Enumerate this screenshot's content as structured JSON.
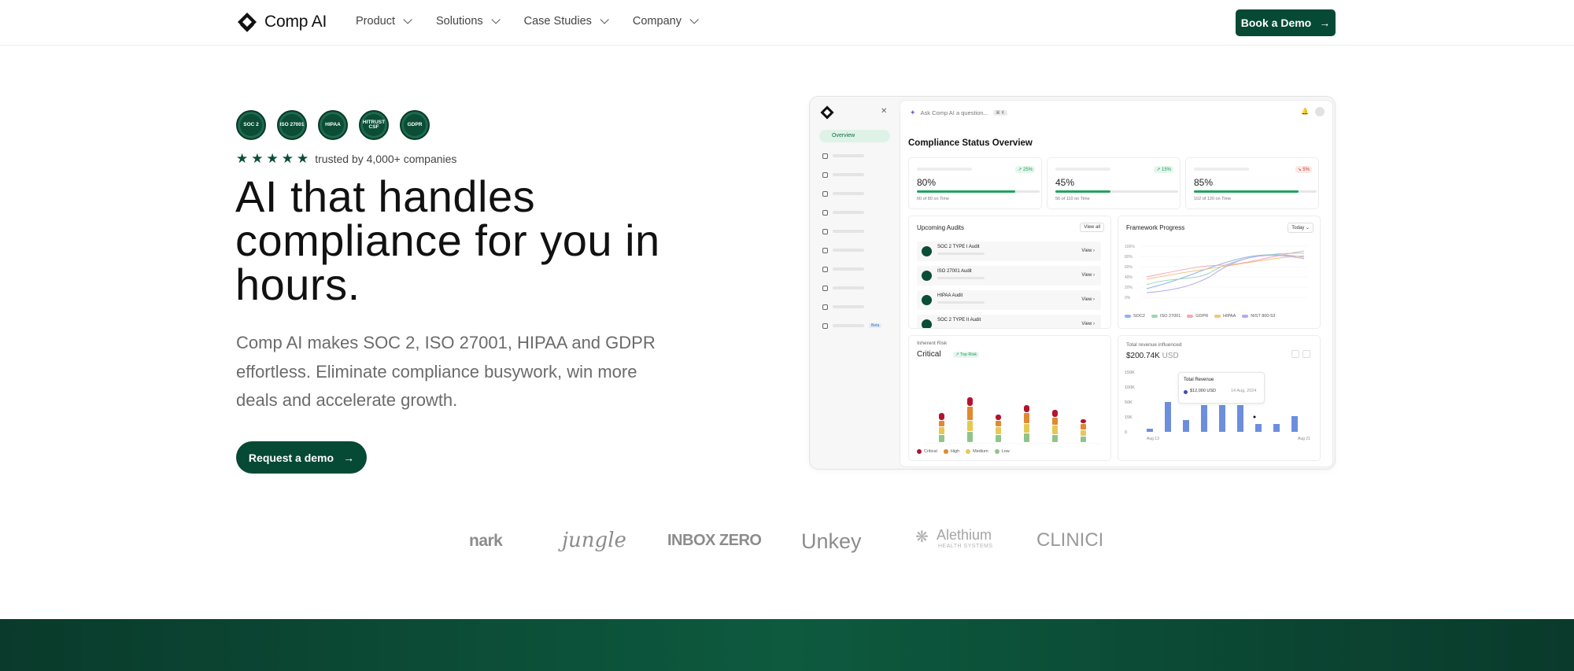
{
  "brand": {
    "name": "Comp AI"
  },
  "nav": {
    "items": [
      {
        "label": "Product"
      },
      {
        "label": "Solutions"
      },
      {
        "label": "Case Studies"
      },
      {
        "label": "Company"
      }
    ],
    "cta_label": "Book a Demo"
  },
  "hero": {
    "badges": [
      "SOC 2",
      "ISO 27001",
      "HIPAA",
      "HITRUST CSF",
      "GDPR"
    ],
    "rating_stars": 5,
    "trust_text": "trusted by 4,000+ companies",
    "headline": "AI that handles compliance for you in hours.",
    "subtext": "Comp AI makes SOC 2, ISO 27001, HIPAA and GDPR effortless. Eliminate compliance busywork, win more deals and accelerate growth.",
    "cta_label": "Request a demo"
  },
  "dashboard": {
    "search_placeholder": "Ask Comp AI a question...",
    "search_shortcut": "⌘ K",
    "sidebar_active": "Overview",
    "sidebar_badge": "Beta",
    "title": "Compliance Status Overview",
    "stats": [
      {
        "percent": "80%",
        "fill": 0.8,
        "sub": "60 of 80 on Time",
        "delta": "↗ 25%",
        "trend": "up"
      },
      {
        "percent": "45%",
        "fill": 0.45,
        "sub": "56 of 110 on Time",
        "delta": "↗ 15%",
        "trend": "up"
      },
      {
        "percent": "85%",
        "fill": 0.85,
        "sub": "102 of 120 on Time",
        "delta": "↘ 5%",
        "trend": "down"
      }
    ],
    "audits": {
      "title": "Upcoming Audits",
      "view_all": "View all",
      "view_label": "View",
      "items": [
        "SOC 2 TYPE I Audit",
        "ISO 27001 Audit",
        "HIPAA Audit",
        "SOC 2 TYPE II Audit"
      ]
    },
    "framework": {
      "title": "Framework Progress",
      "period": "Today",
      "y_ticks": [
        "100%",
        "80%",
        "60%",
        "40%",
        "20%",
        "0%"
      ],
      "legend": [
        "SOC2",
        "ISO 27001",
        "GDPR",
        "HIPAA",
        "NIST 800-53"
      ],
      "colors": [
        "#8fb4e8",
        "#9ad6b8",
        "#f2a7b5",
        "#f3c47d",
        "#b9a8ec"
      ]
    },
    "risk": {
      "label": "Inherent Risk",
      "level": "Critical",
      "tag": "↗ Top Risk",
      "legend": [
        "Critical",
        "High",
        "Medium",
        "Low"
      ],
      "colors": [
        "#b3132f",
        "#e0892e",
        "#e6c955",
        "#8fc48b"
      ]
    },
    "revenue": {
      "label": "Total revenue influenced",
      "value": "$200.74K",
      "currency": "USD",
      "tooltip_title": "Total Revenue",
      "tooltip_value": "$12,000 USD",
      "tooltip_date": "14 Aug, 2024",
      "y_ticks": [
        "150K",
        "100K",
        "50K",
        "15K",
        "0"
      ],
      "x_start": "Aug 13",
      "x_end": "Aug 21"
    }
  },
  "customer_logos": [
    "nark",
    "jungle",
    "INBOX ZERO",
    "Unkey",
    "Alethium",
    "HEALTH SYSTEMS",
    "CLINICI"
  ]
}
